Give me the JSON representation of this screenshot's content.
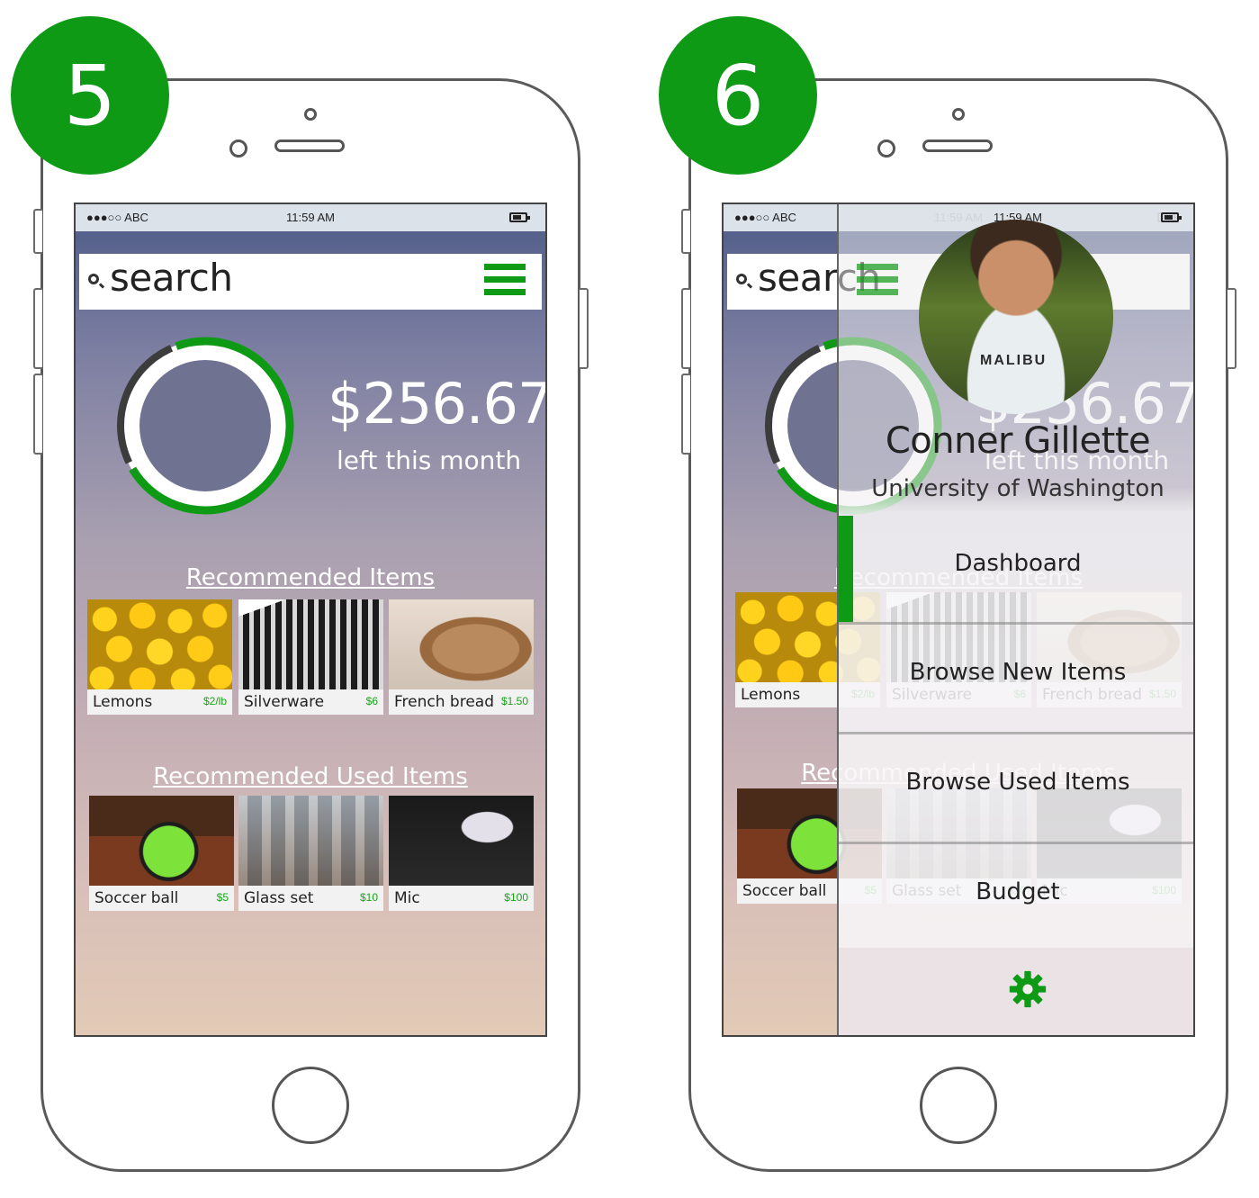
{
  "steps": [
    {
      "number": "5"
    },
    {
      "number": "6"
    }
  ],
  "status": {
    "carrier": "●●●○○ ABC",
    "time": "11:59 AM"
  },
  "search": {
    "text": "search"
  },
  "budget": {
    "amount": "$256.67",
    "caption": "left this month",
    "remaining_fraction": 0.72
  },
  "sections": {
    "recommended": "Recommended Items",
    "used": "Recommended Used Items"
  },
  "recommended_items": [
    {
      "name": "Lemons",
      "price": "$2/lb",
      "icon": "lemons-photo"
    },
    {
      "name": "Silverware",
      "price": "$6",
      "icon": "silverware-photo"
    },
    {
      "name": "French bread",
      "price": "$1.50",
      "icon": "bread-photo"
    }
  ],
  "used_items": [
    {
      "name": "Soccer ball",
      "price": "$5",
      "icon": "soccer-ball-photo"
    },
    {
      "name": "Glass set",
      "price": "$10",
      "icon": "glass-set-photo"
    },
    {
      "name": "Mic",
      "price": "$100",
      "icon": "mic-photo"
    }
  ],
  "drawer": {
    "name": "Conner Gillette",
    "school": "University of Washington",
    "shirt_print": "MALIBU",
    "menu": [
      "Dashboard",
      "Browse New Items",
      "Browse Used Items",
      "Budget"
    ],
    "active": "Dashboard"
  },
  "colors": {
    "accent": "#0f9a16",
    "ring_track": "#3c3c3c"
  }
}
